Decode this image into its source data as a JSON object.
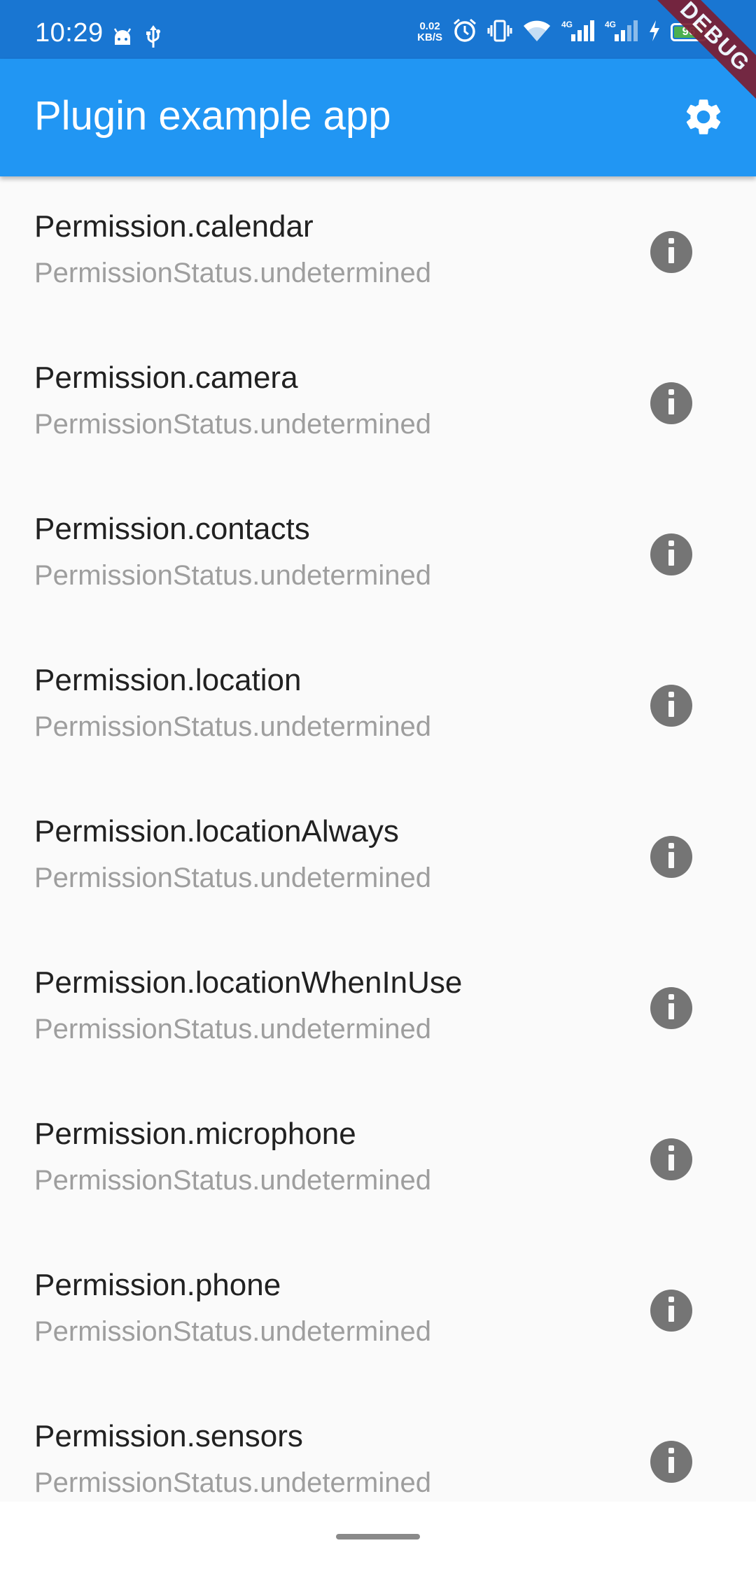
{
  "status_bar": {
    "time": "10:29",
    "net_speed_value": "0.02",
    "net_speed_unit": "KB/S",
    "network_label_1": "4G",
    "network_label_2": "4G",
    "battery_level": "96",
    "icons": [
      "android-icon",
      "usb-icon",
      "alarm-icon",
      "vibrate-icon",
      "wifi-icon",
      "signal-icon",
      "signal-icon",
      "charging-icon",
      "battery-icon"
    ]
  },
  "debug_banner": "DEBUG",
  "app_bar": {
    "title": "Plugin example app",
    "action_icon": "settings-icon"
  },
  "colors": {
    "status_bar": "#1976d2",
    "app_bar": "#2196f3",
    "background": "#fafafa",
    "info_icon": "#757575",
    "subtitle": "#9e9e9e"
  },
  "permissions": [
    {
      "name": "Permission.calendar",
      "status": "PermissionStatus.undetermined"
    },
    {
      "name": "Permission.camera",
      "status": "PermissionStatus.undetermined"
    },
    {
      "name": "Permission.contacts",
      "status": "PermissionStatus.undetermined"
    },
    {
      "name": "Permission.location",
      "status": "PermissionStatus.undetermined"
    },
    {
      "name": "Permission.locationAlways",
      "status": "PermissionStatus.undetermined"
    },
    {
      "name": "Permission.locationWhenInUse",
      "status": "PermissionStatus.undetermined"
    },
    {
      "name": "Permission.microphone",
      "status": "PermissionStatus.undetermined"
    },
    {
      "name": "Permission.phone",
      "status": "PermissionStatus.undetermined"
    },
    {
      "name": "Permission.sensors",
      "status": "PermissionStatus.undetermined"
    }
  ]
}
